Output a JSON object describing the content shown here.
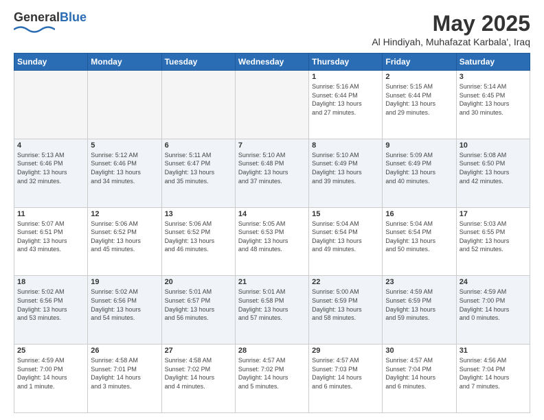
{
  "header": {
    "logo_general": "General",
    "logo_blue": "Blue",
    "month": "May 2025",
    "location": "Al Hindiyah, Muhafazat Karbala', Iraq"
  },
  "days_of_week": [
    "Sunday",
    "Monday",
    "Tuesday",
    "Wednesday",
    "Thursday",
    "Friday",
    "Saturday"
  ],
  "weeks": [
    [
      {
        "day": "",
        "info": "",
        "empty": true
      },
      {
        "day": "",
        "info": "",
        "empty": true
      },
      {
        "day": "",
        "info": "",
        "empty": true
      },
      {
        "day": "",
        "info": "",
        "empty": true
      },
      {
        "day": "1",
        "info": "Sunrise: 5:16 AM\nSunset: 6:44 PM\nDaylight: 13 hours\nand 27 minutes."
      },
      {
        "day": "2",
        "info": "Sunrise: 5:15 AM\nSunset: 6:44 PM\nDaylight: 13 hours\nand 29 minutes."
      },
      {
        "day": "3",
        "info": "Sunrise: 5:14 AM\nSunset: 6:45 PM\nDaylight: 13 hours\nand 30 minutes."
      }
    ],
    [
      {
        "day": "4",
        "info": "Sunrise: 5:13 AM\nSunset: 6:46 PM\nDaylight: 13 hours\nand 32 minutes."
      },
      {
        "day": "5",
        "info": "Sunrise: 5:12 AM\nSunset: 6:46 PM\nDaylight: 13 hours\nand 34 minutes."
      },
      {
        "day": "6",
        "info": "Sunrise: 5:11 AM\nSunset: 6:47 PM\nDaylight: 13 hours\nand 35 minutes."
      },
      {
        "day": "7",
        "info": "Sunrise: 5:10 AM\nSunset: 6:48 PM\nDaylight: 13 hours\nand 37 minutes."
      },
      {
        "day": "8",
        "info": "Sunrise: 5:10 AM\nSunset: 6:49 PM\nDaylight: 13 hours\nand 39 minutes."
      },
      {
        "day": "9",
        "info": "Sunrise: 5:09 AM\nSunset: 6:49 PM\nDaylight: 13 hours\nand 40 minutes."
      },
      {
        "day": "10",
        "info": "Sunrise: 5:08 AM\nSunset: 6:50 PM\nDaylight: 13 hours\nand 42 minutes."
      }
    ],
    [
      {
        "day": "11",
        "info": "Sunrise: 5:07 AM\nSunset: 6:51 PM\nDaylight: 13 hours\nand 43 minutes."
      },
      {
        "day": "12",
        "info": "Sunrise: 5:06 AM\nSunset: 6:52 PM\nDaylight: 13 hours\nand 45 minutes."
      },
      {
        "day": "13",
        "info": "Sunrise: 5:06 AM\nSunset: 6:52 PM\nDaylight: 13 hours\nand 46 minutes."
      },
      {
        "day": "14",
        "info": "Sunrise: 5:05 AM\nSunset: 6:53 PM\nDaylight: 13 hours\nand 48 minutes."
      },
      {
        "day": "15",
        "info": "Sunrise: 5:04 AM\nSunset: 6:54 PM\nDaylight: 13 hours\nand 49 minutes."
      },
      {
        "day": "16",
        "info": "Sunrise: 5:04 AM\nSunset: 6:54 PM\nDaylight: 13 hours\nand 50 minutes."
      },
      {
        "day": "17",
        "info": "Sunrise: 5:03 AM\nSunset: 6:55 PM\nDaylight: 13 hours\nand 52 minutes."
      }
    ],
    [
      {
        "day": "18",
        "info": "Sunrise: 5:02 AM\nSunset: 6:56 PM\nDaylight: 13 hours\nand 53 minutes."
      },
      {
        "day": "19",
        "info": "Sunrise: 5:02 AM\nSunset: 6:56 PM\nDaylight: 13 hours\nand 54 minutes."
      },
      {
        "day": "20",
        "info": "Sunrise: 5:01 AM\nSunset: 6:57 PM\nDaylight: 13 hours\nand 56 minutes."
      },
      {
        "day": "21",
        "info": "Sunrise: 5:01 AM\nSunset: 6:58 PM\nDaylight: 13 hours\nand 57 minutes."
      },
      {
        "day": "22",
        "info": "Sunrise: 5:00 AM\nSunset: 6:59 PM\nDaylight: 13 hours\nand 58 minutes."
      },
      {
        "day": "23",
        "info": "Sunrise: 4:59 AM\nSunset: 6:59 PM\nDaylight: 13 hours\nand 59 minutes."
      },
      {
        "day": "24",
        "info": "Sunrise: 4:59 AM\nSunset: 7:00 PM\nDaylight: 14 hours\nand 0 minutes."
      }
    ],
    [
      {
        "day": "25",
        "info": "Sunrise: 4:59 AM\nSunset: 7:00 PM\nDaylight: 14 hours\nand 1 minute."
      },
      {
        "day": "26",
        "info": "Sunrise: 4:58 AM\nSunset: 7:01 PM\nDaylight: 14 hours\nand 3 minutes."
      },
      {
        "day": "27",
        "info": "Sunrise: 4:58 AM\nSunset: 7:02 PM\nDaylight: 14 hours\nand 4 minutes."
      },
      {
        "day": "28",
        "info": "Sunrise: 4:57 AM\nSunset: 7:02 PM\nDaylight: 14 hours\nand 5 minutes."
      },
      {
        "day": "29",
        "info": "Sunrise: 4:57 AM\nSunset: 7:03 PM\nDaylight: 14 hours\nand 6 minutes."
      },
      {
        "day": "30",
        "info": "Sunrise: 4:57 AM\nSunset: 7:04 PM\nDaylight: 14 hours\nand 6 minutes."
      },
      {
        "day": "31",
        "info": "Sunrise: 4:56 AM\nSunset: 7:04 PM\nDaylight: 14 hours\nand 7 minutes."
      }
    ]
  ]
}
